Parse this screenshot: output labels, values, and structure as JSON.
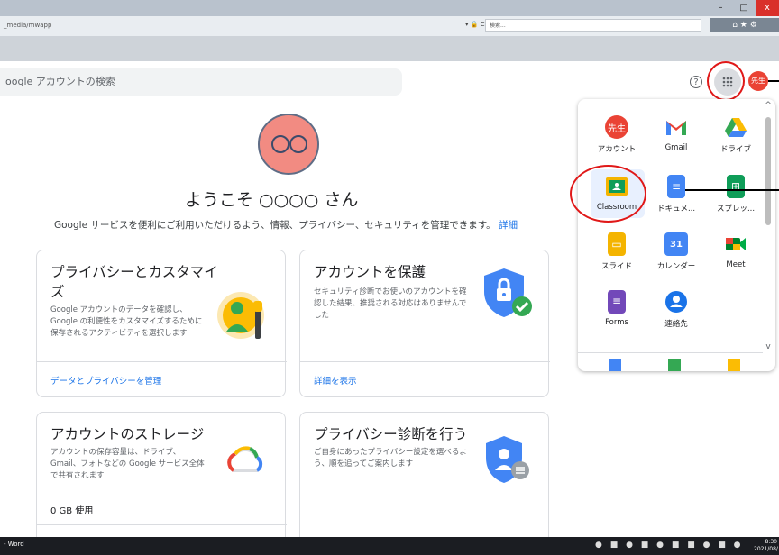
{
  "browser": {
    "url": "_media/mwapp",
    "address_controls": "▾ 🔒 C",
    "search_placeholder": "検索...",
    "window_min": "–",
    "window_max": "□",
    "window_close": "x",
    "nav_icons": "⌂ ★ ⚙"
  },
  "header": {
    "search_placeholder": "oogle アカウントの検索",
    "help_symbol": "?",
    "avatar_text": "先生"
  },
  "welcome": {
    "greeting": "ようこそ ○○○○ さん",
    "subtitle": "Google サービスを便利にご利用いただけるよう、情報、プライバシー、セキュリティを管理できます。",
    "subtitle_link": "詳細"
  },
  "cards": [
    {
      "title": "プライバシーとカスタマイズ",
      "body": "Google アカウントのデータを確認し、Google の利便性をカスタマイズするために保存されるアクティビティを選択します",
      "link": "データとプライバシーを管理"
    },
    {
      "title": "アカウントを保護",
      "body": "セキュリティ診断でお使いのアカウントを確認した結果、推奨される対応はありませんでした",
      "link": "詳細を表示"
    },
    {
      "title": "アカウントのストレージ",
      "body": "アカウントの保存容量は、ドライブ、Gmail、フォトなどの Google サービス全体で共有されます",
      "value": "0 GB 使用"
    },
    {
      "title": "プライバシー診断を行う",
      "body": "ご自身にあったプライバシー設定を選べるよう、順を追ってご案内します"
    }
  ],
  "apps": [
    {
      "label": "アカウント",
      "icon": "account-icon",
      "glyph": "先生",
      "color": "#ea4335"
    },
    {
      "label": "Gmail",
      "icon": "gmail-icon",
      "glyph": "M",
      "color": "#ffffff"
    },
    {
      "label": "ドライブ",
      "icon": "drive-icon",
      "glyph": "▲",
      "color": "#ffffff"
    },
    {
      "label": "Classroom",
      "icon": "classroom-icon",
      "glyph": "",
      "color": "#0f9d58"
    },
    {
      "label": "ドキュメ...",
      "icon": "docs-icon",
      "glyph": "≡",
      "color": "#4285f4"
    },
    {
      "label": "スプレッ...",
      "icon": "sheets-icon",
      "glyph": "⊞",
      "color": "#0f9d58"
    },
    {
      "label": "スライド",
      "icon": "slides-icon",
      "glyph": "▭",
      "color": "#f4b400"
    },
    {
      "label": "カレンダー",
      "icon": "calendar-icon",
      "glyph": "31",
      "color": "#4285f4"
    },
    {
      "label": "Meet",
      "icon": "meet-icon",
      "glyph": "▶",
      "color": "#00897b"
    },
    {
      "label": "Forms",
      "icon": "forms-icon",
      "glyph": "≣",
      "color": "#7248b9"
    },
    {
      "label": "連絡先",
      "icon": "contacts-icon",
      "glyph": "●",
      "color": "#1a73e8"
    }
  ],
  "taskbar": {
    "app_label": "- Word",
    "time": "8:30",
    "date": "2021/08/"
  }
}
